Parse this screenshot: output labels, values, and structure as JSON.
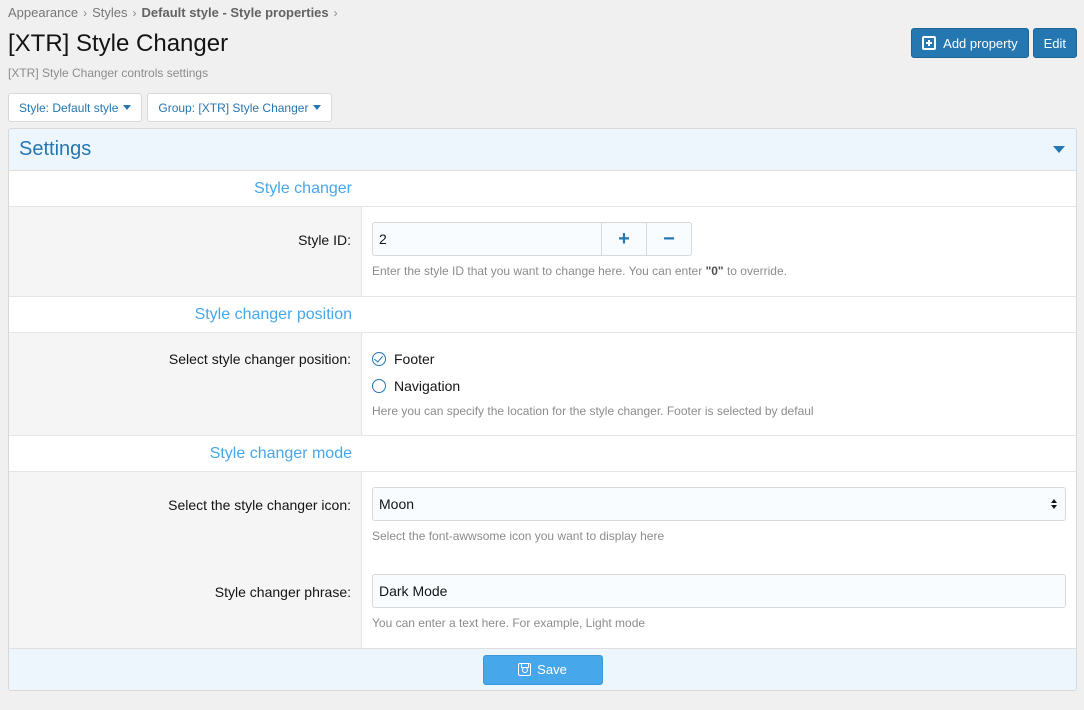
{
  "breadcrumb": {
    "items": [
      "Appearance",
      "Styles",
      "Default style - Style properties"
    ],
    "separator": "›"
  },
  "header": {
    "title": "[XTR] Style Changer",
    "description": "[XTR] Style Changer controls settings",
    "add_property_label": "Add property",
    "edit_label": "Edit"
  },
  "filters": {
    "style_label": "Style: Default style",
    "group_label": "Group: [XTR] Style Changer"
  },
  "block": {
    "title": "Settings",
    "sections": {
      "style_changer": {
        "heading": "Style changer",
        "style_id_label": "Style ID:",
        "style_id_value": "2",
        "plus_label": "+",
        "minus_label": "−",
        "hint_pre": "Enter the style ID that you want to change here. You can enter ",
        "hint_bold": "\"0\"",
        "hint_post": " to override."
      },
      "position": {
        "heading": "Style changer position",
        "label": "Select style changer position:",
        "options": [
          "Footer",
          "Navigation"
        ],
        "selected": "Footer",
        "hint": "Here you can specify the location for the style changer. Footer is selected by defaul"
      },
      "mode": {
        "heading": "Style changer mode",
        "icon_label": "Select the style changer icon:",
        "icon_value": "Moon",
        "icon_hint": "Select the font-awwsome icon you want to display here",
        "phrase_label": "Style changer phrase:",
        "phrase_value": "Dark Mode",
        "phrase_hint": "You can enter a text here. For example, Light mode"
      }
    },
    "save_label": "Save"
  },
  "colors": {
    "accent": "#2577b1",
    "section_heading": "#47a7eb",
    "save_button": "#47a7eb",
    "header_bg": "#edf6fd"
  }
}
